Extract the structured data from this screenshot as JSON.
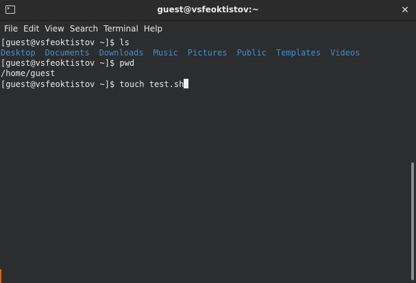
{
  "window": {
    "title": "guest@vsfeoktistov:~",
    "close_label": "✕"
  },
  "menu": {
    "items": [
      "File",
      "Edit",
      "View",
      "Search",
      "Terminal",
      "Help"
    ]
  },
  "terminal": {
    "line1_prompt": "[guest@vsfeoktistov ~]$ ",
    "line1_cmd": "ls",
    "dirs": [
      "Desktop",
      "Documents",
      "Downloads",
      "Music",
      "Pictures",
      "Public",
      "Templates",
      "Videos"
    ],
    "line3_prompt": "[guest@vsfeoktistov ~]$ ",
    "line3_cmd": "pwd",
    "line4_output": "/home/guest",
    "line5_prompt": "[guest@vsfeoktistov ~]$ ",
    "line5_cmd": "touch test.sh"
  },
  "colors": {
    "background": "#2b2d2e",
    "text": "#e8e8e8",
    "directory": "#3e8fd6"
  }
}
